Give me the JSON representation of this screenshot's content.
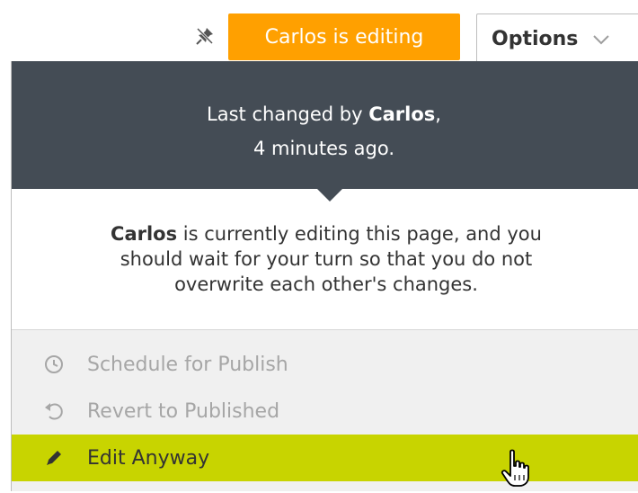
{
  "toolbar": {
    "pin_icon": "pin-slash-icon",
    "editing_badge": "Carlos is editing",
    "options_label": "Options",
    "chevron_icon": "chevron-down-icon"
  },
  "panel": {
    "header_prefix": "Last changed by ",
    "header_user": "Carlos",
    "header_suffix": ",",
    "header_time": "4 minutes ago.",
    "message_user": "Carlos",
    "message_line1_rest": " is currently editing this page, and you",
    "message_line2": "should wait for your turn so that you do not",
    "message_line3": "overwrite each other's changes."
  },
  "menu": {
    "items": [
      {
        "label": "Schedule for Publish",
        "icon": "clock-icon",
        "state": "disabled"
      },
      {
        "label": "Revert to Published",
        "icon": "undo-icon",
        "state": "disabled"
      },
      {
        "label": "Edit Anyway",
        "icon": "pencil-icon",
        "state": "hover"
      }
    ]
  },
  "colors": {
    "badge": "#ffa000",
    "header_bg": "#444c55",
    "menu_bg": "#f0f0f0",
    "highlight": "#c8d400",
    "disabled_text": "#a6a6a6"
  },
  "cursor_icon": "hand-pointer-icon"
}
